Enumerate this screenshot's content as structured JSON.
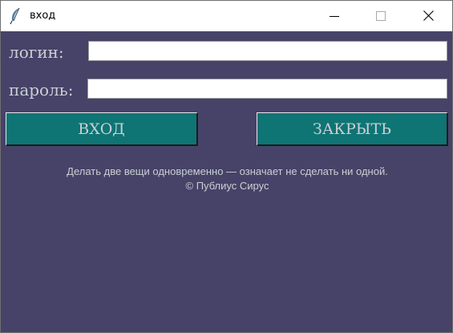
{
  "window": {
    "title": "вход"
  },
  "form": {
    "login_label": "логин:",
    "login_value": "",
    "password_label": "пароль:",
    "password_value": ""
  },
  "buttons": {
    "login": "ВХОД",
    "close": "ЗАКРЫТЬ"
  },
  "quote": {
    "text": "Делать две вещи одновременно — означает не сделать ни одной.",
    "author": "© Публиус Сирус"
  },
  "colors": {
    "background": "#474268",
    "button": "#0f7474",
    "text": "#c9d0d4"
  },
  "icons": {
    "app": "feather-icon",
    "minimize": "minimize-icon",
    "maximize": "maximize-icon",
    "close": "close-icon"
  }
}
